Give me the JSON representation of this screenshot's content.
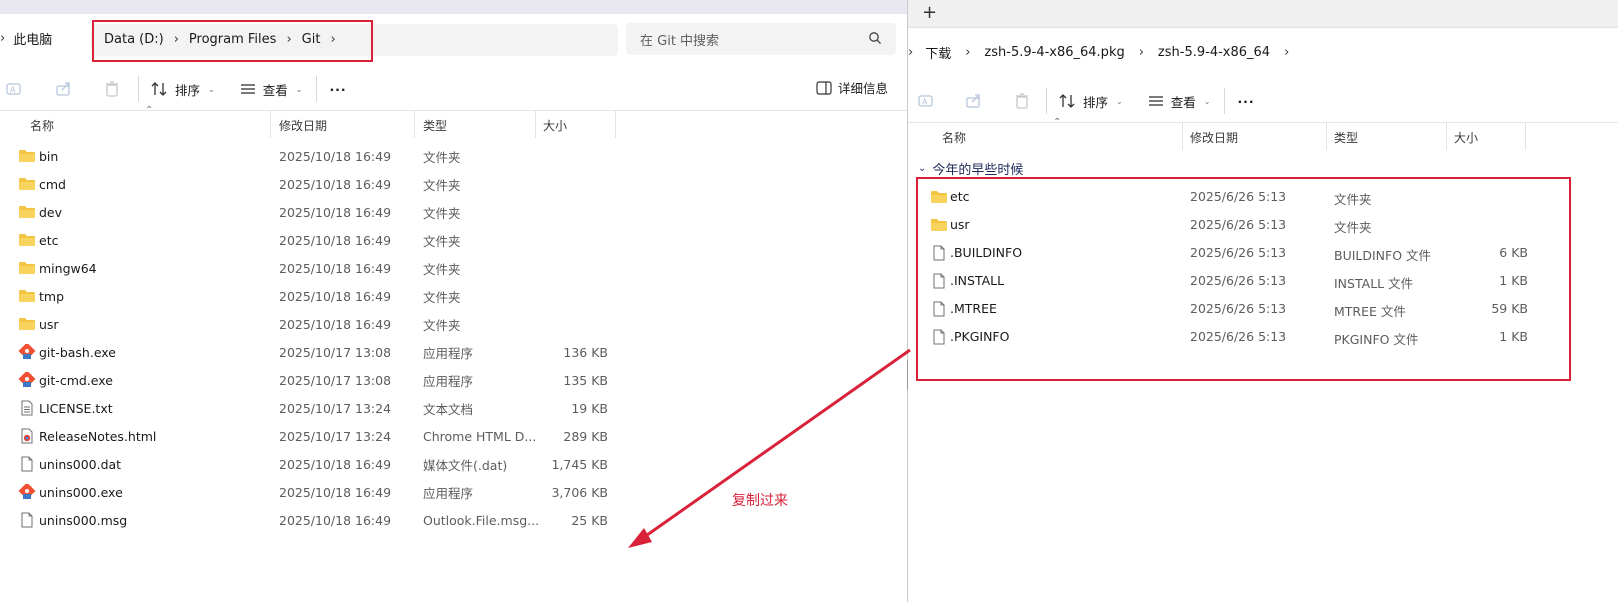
{
  "left": {
    "root_crumb": "此电脑",
    "crumbs": [
      "Data (D:)",
      "Program Files",
      "Git"
    ],
    "search_placeholder": "在 Git 中搜索",
    "toolbar": {
      "sort_label": "排序",
      "view_label": "查看",
      "more_label": "···",
      "details_label": "详细信息"
    },
    "columns": [
      "名称",
      "修改日期",
      "类型",
      "大小"
    ],
    "rows": [
      {
        "name": "bin",
        "date": "2025/10/18 16:49",
        "type": "文件夹",
        "size": "",
        "icon": "folder-icon"
      },
      {
        "name": "cmd",
        "date": "2025/10/18 16:49",
        "type": "文件夹",
        "size": "",
        "icon": "folder-icon"
      },
      {
        "name": "dev",
        "date": "2025/10/18 16:49",
        "type": "文件夹",
        "size": "",
        "icon": "folder-icon"
      },
      {
        "name": "etc",
        "date": "2025/10/18 16:49",
        "type": "文件夹",
        "size": "",
        "icon": "folder-icon"
      },
      {
        "name": "mingw64",
        "date": "2025/10/18 16:49",
        "type": "文件夹",
        "size": "",
        "icon": "folder-icon"
      },
      {
        "name": "tmp",
        "date": "2025/10/18 16:49",
        "type": "文件夹",
        "size": "",
        "icon": "folder-icon"
      },
      {
        "name": "usr",
        "date": "2025/10/18 16:49",
        "type": "文件夹",
        "size": "",
        "icon": "folder-icon"
      },
      {
        "name": "git-bash.exe",
        "date": "2025/10/17 13:08",
        "type": "应用程序",
        "size": "136 KB",
        "icon": "git-app-icon"
      },
      {
        "name": "git-cmd.exe",
        "date": "2025/10/17 13:08",
        "type": "应用程序",
        "size": "135 KB",
        "icon": "git-app-icon"
      },
      {
        "name": "LICENSE.txt",
        "date": "2025/10/17 13:24",
        "type": "文本文档",
        "size": "19 KB",
        "icon": "text-file-icon"
      },
      {
        "name": "ReleaseNotes.html",
        "date": "2025/10/17 13:24",
        "type": "Chrome HTML D...",
        "size": "289 KB",
        "icon": "chrome-icon"
      },
      {
        "name": "unins000.dat",
        "date": "2025/10/18 16:49",
        "type": "媒体文件(.dat)",
        "size": "1,745 KB",
        "icon": "file-icon"
      },
      {
        "name": "unins000.exe",
        "date": "2025/10/18 16:49",
        "type": "应用程序",
        "size": "3,706 KB",
        "icon": "git-app-icon"
      },
      {
        "name": "unins000.msg",
        "date": "2025/10/18 16:49",
        "type": "Outlook.File.msg...",
        "size": "25 KB",
        "icon": "file-icon"
      }
    ]
  },
  "right": {
    "tab_add": "+",
    "crumbs": [
      "下载",
      "zsh-5.9-4-x86_64.pkg",
      "zsh-5.9-4-x86_64"
    ],
    "toolbar": {
      "sort_label": "排序",
      "view_label": "查看",
      "more_label": "···"
    },
    "columns": [
      "名称",
      "修改日期",
      "类型",
      "大小"
    ],
    "group_label": "今年的早些时候",
    "rows": [
      {
        "name": "etc",
        "date": "2025/6/26 5:13",
        "type": "文件夹",
        "size": "",
        "icon": "folder-icon"
      },
      {
        "name": "usr",
        "date": "2025/6/26 5:13",
        "type": "文件夹",
        "size": "",
        "icon": "folder-icon"
      },
      {
        "name": ".BUILDINFO",
        "date": "2025/6/26 5:13",
        "type": "BUILDINFO 文件",
        "size": "6 KB",
        "icon": "file-icon"
      },
      {
        "name": ".INSTALL",
        "date": "2025/6/26 5:13",
        "type": "INSTALL 文件",
        "size": "1 KB",
        "icon": "file-icon"
      },
      {
        "name": ".MTREE",
        "date": "2025/6/26 5:13",
        "type": "MTREE 文件",
        "size": "59 KB",
        "icon": "file-icon"
      },
      {
        "name": ".PKGINFO",
        "date": "2025/6/26 5:13",
        "type": "PKGINFO 文件",
        "size": "1 KB",
        "icon": "file-icon"
      }
    ]
  },
  "annotation": {
    "label": "复制过来",
    "color": "#d9223a"
  },
  "colors": {
    "folder": "#f4c542",
    "highlight": "#d9223a",
    "accent_blue": "#1f2a5a"
  }
}
